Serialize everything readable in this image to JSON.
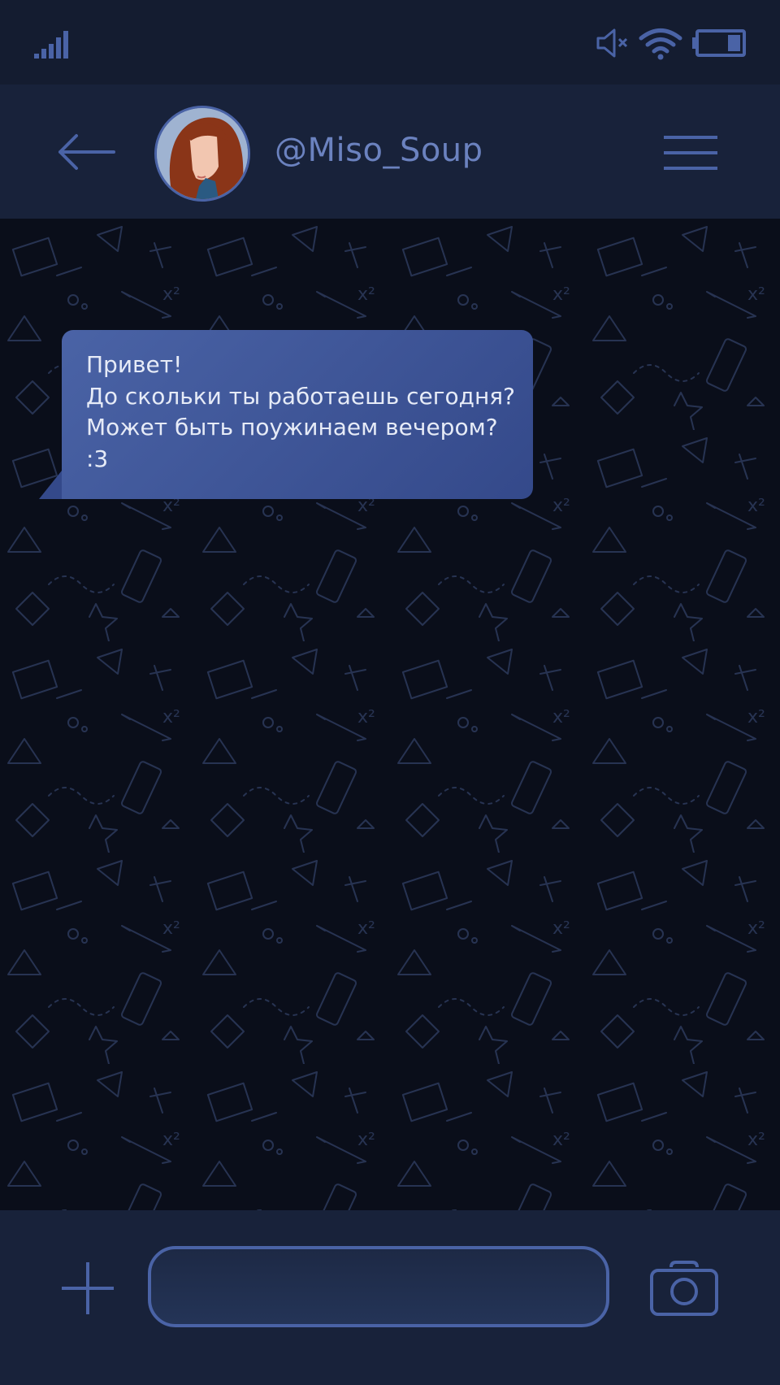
{
  "status_bar": {
    "icons": [
      "signal-icon",
      "mute-icon",
      "wifi-icon",
      "battery-icon"
    ]
  },
  "header": {
    "username": "@Miso_Soup",
    "icons": [
      "back-arrow-icon",
      "avatar",
      "hamburger-menu-icon"
    ]
  },
  "chat": {
    "messages": [
      {
        "direction": "incoming",
        "lines": [
          "Привет!",
          "До скольки ты работаешь сегодня?",
          "Может быть поужинаем вечером?",
          ":3"
        ]
      }
    ]
  },
  "composer": {
    "input_value": "",
    "input_placeholder": "",
    "icons": [
      "plus-icon",
      "camera-icon"
    ]
  },
  "colors": {
    "status_bar_bg": "#141c30",
    "header_bg": "#18223a",
    "chat_bg": "#0a0e1a",
    "accent": "#4a63a6",
    "username": "#6b82bf",
    "message_text": "#e6ebf7"
  }
}
